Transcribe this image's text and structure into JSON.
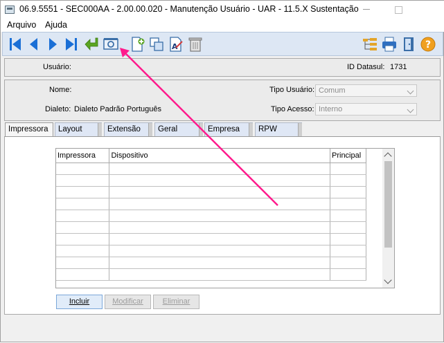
{
  "window": {
    "title": "06.9.5551 - SEC000AA - 2.00.00.020 - Manutenção Usuário - UAR - 11.5.X Sustentação"
  },
  "menu": {
    "items": [
      "Arquivo",
      "Ajuda"
    ]
  },
  "toolbar": {
    "buttons": [
      "first-icon",
      "previous-icon",
      "next-icon",
      "last-icon",
      "return-icon",
      "zoom-icon",
      "new-document-icon",
      "copy-icon",
      "edit-icon",
      "delete-icon",
      "tree-icon",
      "print-icon",
      "exit-icon",
      "help-icon"
    ]
  },
  "header": {
    "usuario_label": "Usuário:",
    "usuario_value": "",
    "id_label": "ID Datasul:",
    "id_value": "1731"
  },
  "details": {
    "nome_label": "Nome:",
    "nome_value": "",
    "dialeto_label": "Dialeto:",
    "dialeto_value": "Dialeto Padrão Português",
    "tipo_usuario_label": "Tipo Usuário:",
    "tipo_usuario_value": "Comum",
    "tipo_acesso_label": "Tipo Acesso:",
    "tipo_acesso_value": "Interno"
  },
  "tabs": [
    "Impressora",
    "Layout",
    "Extensão",
    "Geral",
    "Empresa",
    "RPW"
  ],
  "grid": {
    "columns": [
      "Impressora",
      "Dispositivo",
      "Principal"
    ],
    "rows": []
  },
  "actions": {
    "incluir": "Incluir",
    "modificar": "Modificar",
    "eliminar": "Eliminar"
  },
  "colors": {
    "toolbar_bg": "#dde7f4",
    "annotation_arrow": "#ff1a8c",
    "tab_bg": "#dfe7f5"
  }
}
